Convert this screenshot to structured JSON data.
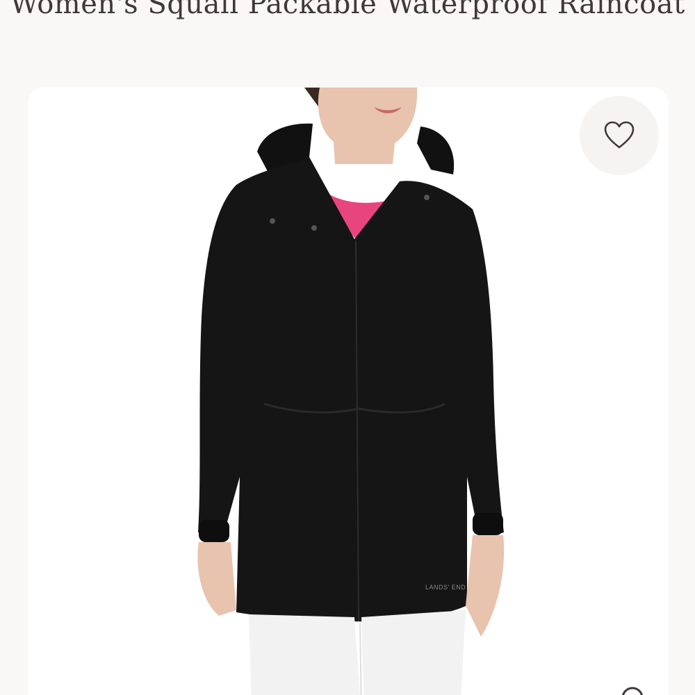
{
  "product": {
    "title": "Women's Squall Packable Waterproof Raincoat",
    "image_alt": "Model wearing black hooded waterproof raincoat over pink top with white pants",
    "logo_text": "LANDS' END"
  },
  "icons": {
    "favorite": "heart-outline-icon",
    "zoom": "zoom-icon"
  },
  "colors": {
    "background": "#faf8f6",
    "title_text": "#3e3a39",
    "jacket": "#141414",
    "top": "#e8457f",
    "pants": "#f2f2f2"
  }
}
